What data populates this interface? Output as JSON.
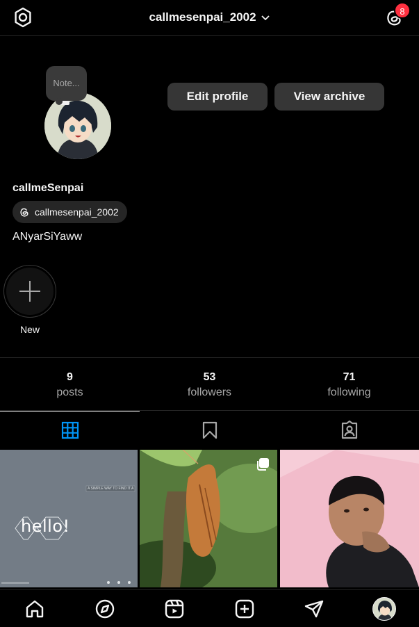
{
  "header": {
    "username": "callmesenpai_2002",
    "notification_count": "8"
  },
  "profile": {
    "note": "Note...",
    "edit_profile_label": "Edit profile",
    "view_archive_label": "View archive",
    "display_name": "callmeSenpai",
    "threads_handle": "callmesenpai_2002",
    "bio": "ANyarSiYaww"
  },
  "highlights": {
    "new_label": "New"
  },
  "stats": [
    {
      "value": "9",
      "label": "posts"
    },
    {
      "value": "53",
      "label": "followers"
    },
    {
      "value": "71",
      "label": "following"
    }
  ],
  "tabs": [
    {
      "icon": "grid-icon",
      "active": true
    },
    {
      "icon": "bookmark-icon",
      "active": false
    },
    {
      "icon": "tagged-icon",
      "active": false
    }
  ],
  "posts": [
    {
      "image_text": "hello!",
      "footer_text": "A SIMPLE WAY TO FIND IT ALL",
      "multi": false
    },
    {
      "image_text": "",
      "footer_text": "",
      "multi": true
    },
    {
      "image_text": "",
      "footer_text": "",
      "multi": false
    }
  ],
  "colors": {
    "background": "#000000",
    "button": "#363636",
    "badge": "#ff3040",
    "active_tab": "#0095f6",
    "muted_text": "#a8a8a8"
  },
  "bottom_nav": [
    "home-icon",
    "explore-icon",
    "reels-icon",
    "create-icon",
    "direct-icon",
    "profile-avatar"
  ]
}
